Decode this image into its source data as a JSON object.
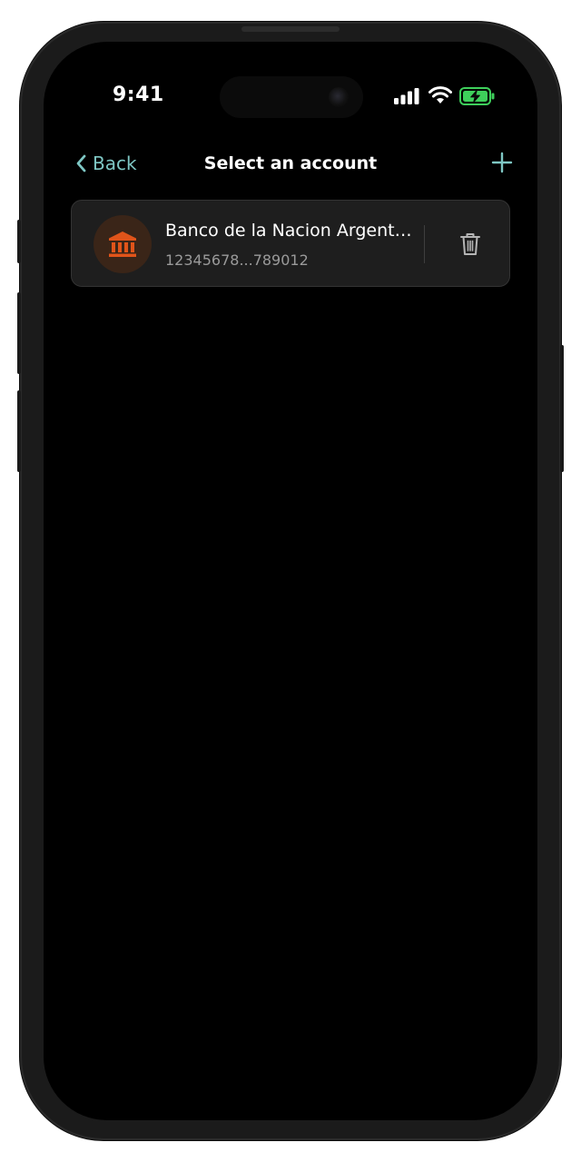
{
  "status_bar": {
    "time": "9:41",
    "icons": [
      "cellular-signal-icon",
      "wifi-icon",
      "battery-charging-icon"
    ]
  },
  "nav": {
    "back_label": "Back",
    "title": "Select an account",
    "add_icon": "plus-icon"
  },
  "accounts": [
    {
      "name": "Banco de la Nacion Argentina",
      "number": "12345678...789012",
      "icon": "bank-icon",
      "action_icon": "trash-icon"
    }
  ],
  "colors": {
    "accent": "#7ec7c4",
    "bank_icon": "#e0541a",
    "battery": "#3ecf5b",
    "background": "#000000",
    "card": "#1e1e1e"
  }
}
